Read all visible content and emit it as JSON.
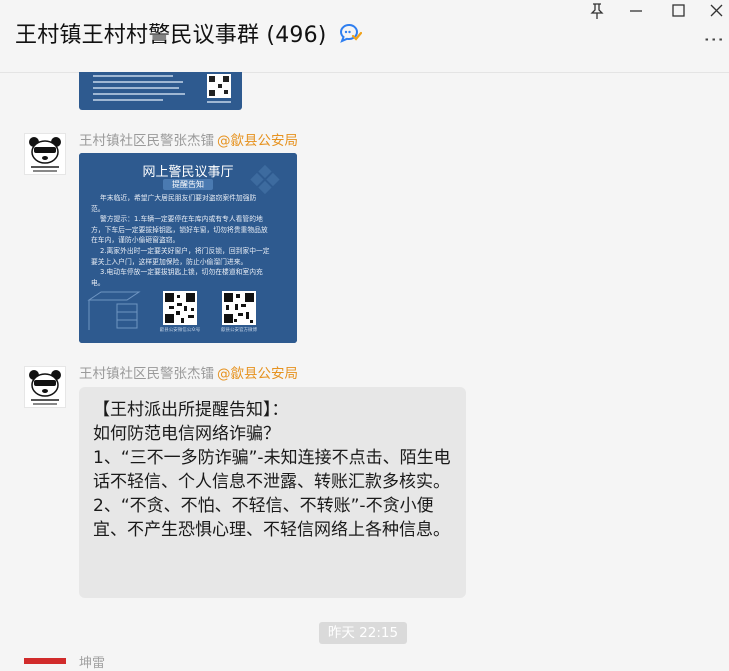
{
  "window": {
    "title": "王村镇王村村警民议事群",
    "member_count": "(496)",
    "more_label": "⋮"
  },
  "messages": [
    {
      "sender": "王村镇社区民警张杰镭",
      "mention": "@歙县公安局",
      "image": {
        "heading": "网上警民议事厅",
        "subheading": "提醒告知",
        "body_lines": [
          "年末临近，希望广大居民朋友们要对盗窃案件加强防",
          "范。",
          "警方提示：1.车辆一定要停在车库内或有专人看管的地",
          "方，下车后一定要拔掉钥匙，锁好车窗，切勿将贵重物品放",
          "在车内，谨防小偷砸窗盗窃。",
          "2.离家外出时一定要关好窗户，将门反锁，回到家中一定",
          "要关上入户门，这样更加保险，防止小偷溜门进来。",
          "3.电动车停放一定要拔钥匙上锁，切勿在楼道和室内充",
          "电。"
        ],
        "qr_caption_left": "歙县公安微信公众号",
        "qr_caption_right": "歙县公安官方微博"
      }
    },
    {
      "sender": "王村镇社区民警张杰镭",
      "mention": "@歙县公安局",
      "text": "【王村派出所提醒告知】：\n如何防范电信网络诈骗？\n1、“三不一多防诈骗”-未知连接不点击、陌生电话不轻信、个人信息不泄露、转账汇款多核实。\n2、“不贪、不怕、不轻信、不转账”-不贪小便宜、不产生恐惧心理、不轻信网络上各种信息。"
    }
  ],
  "timestamp": "昨天 22:15",
  "next_sender_partial": "坤雷",
  "colors": {
    "poster_blue": "#2e5a8f",
    "mention_orange": "#e6921f",
    "bubble_gray": "#e7e7e7"
  }
}
